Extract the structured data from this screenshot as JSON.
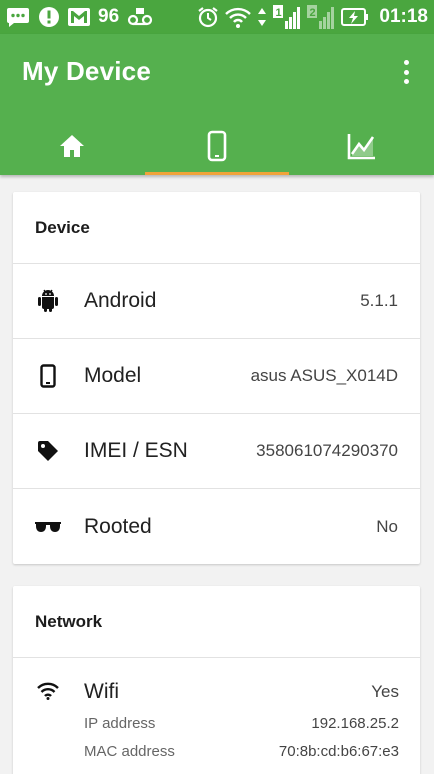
{
  "status_bar": {
    "battery_level": "96",
    "time": "01:18",
    "sim1_label": "1",
    "sim2_label": "2"
  },
  "app_bar": {
    "title": "My Device",
    "tabs": [
      {
        "icon": "home-icon",
        "selected": false
      },
      {
        "icon": "phone-icon",
        "selected": true
      },
      {
        "icon": "chart-icon",
        "selected": false
      }
    ],
    "accent_color": "#55b04e",
    "indicator_color": "#f0a33a"
  },
  "page_marker": "1",
  "device_card": {
    "header": "Device",
    "rows": [
      {
        "icon": "android-icon",
        "label": "Android",
        "value": "5.1.1"
      },
      {
        "icon": "smartphone-icon",
        "label": "Model",
        "value": "asus ASUS_X014D"
      },
      {
        "icon": "tag-icon",
        "label": "IMEI / ESN",
        "value": "358061074290370"
      },
      {
        "icon": "sunglasses-icon",
        "label": "Rooted",
        "value": "No"
      }
    ]
  },
  "network_card": {
    "header": "Network",
    "wifi": {
      "icon": "wifi-icon",
      "label": "Wifi",
      "value": "Yes",
      "details": [
        {
          "label": "IP address",
          "value": "192.168.25.2"
        },
        {
          "label": "MAC address",
          "value": "70:8b:cd:b6:67:e3"
        }
      ]
    }
  }
}
